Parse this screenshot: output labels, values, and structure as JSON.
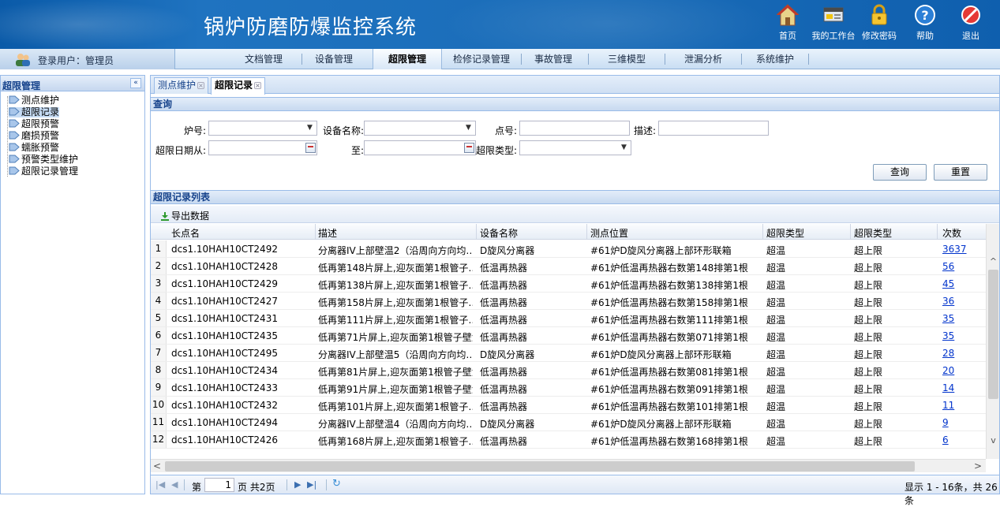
{
  "header": {
    "title": "锅炉防磨防爆监控系统",
    "tools": [
      {
        "icon": "home-icon",
        "label": "首页"
      },
      {
        "icon": "workbench-icon",
        "label": "我的工作台"
      },
      {
        "icon": "lock-icon",
        "label": "修改密码"
      },
      {
        "icon": "help-icon",
        "label": "帮助"
      },
      {
        "icon": "exit-icon",
        "label": "退出"
      }
    ]
  },
  "user": {
    "label": "登录用户：管理员"
  },
  "nav": {
    "items": [
      "文档管理",
      "设备管理",
      "超限管理",
      "检修记录管理",
      "事故管理",
      "三维模型",
      "泄漏分析",
      "系统维护"
    ],
    "active": "超限管理"
  },
  "sidebar": {
    "title": "超限管理",
    "collapse": "«",
    "items": [
      "测点维护",
      "超限记录",
      "超限预警",
      "磨损预警",
      "蠕胀预警",
      "预警类型维护",
      "超限记录管理"
    ],
    "selected": "超限记录"
  },
  "tabs": [
    {
      "label": "测点维护",
      "active": false
    },
    {
      "label": "超限记录",
      "active": true
    }
  ],
  "query": {
    "title": "查询",
    "labels": {
      "furnace": "炉号:",
      "device": "设备名称:",
      "point": "点号:",
      "desc": "描述:",
      "date_from": "超限日期从:",
      "date_to": "至:",
      "type": "超限类型:"
    },
    "values": {
      "furnace": "",
      "device": "",
      "point": "",
      "desc": "",
      "date_from": "",
      "date_to": "",
      "type": ""
    },
    "buttons": {
      "search": "查询",
      "reset": "重置"
    }
  },
  "list": {
    "title": "超限记录列表",
    "export_label": "导出数据",
    "columns": [
      "长点名",
      "描述",
      "设备名称",
      "测点位置",
      "超限类型",
      "超限类型",
      "次数"
    ],
    "rows": [
      {
        "n": "1",
        "c": [
          "dcs1.10HAH10CT2492",
          "分离器IV上部壁温2（沿周向方向均…",
          "D旋风分离器",
          "#61炉D旋风分离器上部环形联箱",
          "超温",
          "超上限",
          "3637"
        ]
      },
      {
        "n": "2",
        "c": [
          "dcs1.10HAH10CT2428",
          "低再第148片屏上,迎灰面第1根管子…",
          "低温再热器",
          "#61炉低温再热器右数第148排第1根",
          "超温",
          "超上限",
          "56"
        ]
      },
      {
        "n": "3",
        "c": [
          "dcs1.10HAH10CT2429",
          "低再第138片屏上,迎灰面第1根管子…",
          "低温再热器",
          "#61炉低温再热器右数第138排第1根",
          "超温",
          "超上限",
          "45"
        ]
      },
      {
        "n": "4",
        "c": [
          "dcs1.10HAH10CT2427",
          "低再第158片屏上,迎灰面第1根管子…",
          "低温再热器",
          "#61炉低温再热器右数第158排第1根",
          "超温",
          "超上限",
          "36"
        ]
      },
      {
        "n": "5",
        "c": [
          "dcs1.10HAH10CT2431",
          "低再第111片屏上,迎灰面第1根管子…",
          "低温再热器",
          "#61炉低温再热器右数第111排第1根",
          "超温",
          "超上限",
          "35"
        ]
      },
      {
        "n": "6",
        "c": [
          "dcs1.10HAH10CT2435",
          "低再第71片屏上,迎灰面第1根管子壁温",
          "低温再热器",
          "#61炉低温再热器右数第071排第1根",
          "超温",
          "超上限",
          "35"
        ]
      },
      {
        "n": "7",
        "c": [
          "dcs1.10HAH10CT2495",
          "分离器IV上部壁温5（沿周向方向均…",
          "D旋风分离器",
          "#61炉D旋风分离器上部环形联箱",
          "超温",
          "超上限",
          "28"
        ]
      },
      {
        "n": "8",
        "c": [
          "dcs1.10HAH10CT2434",
          "低再第81片屏上,迎灰面第1根管子壁温",
          "低温再热器",
          "#61炉低温再热器右数第081排第1根",
          "超温",
          "超上限",
          "20"
        ]
      },
      {
        "n": "9",
        "c": [
          "dcs1.10HAH10CT2433",
          "低再第91片屏上,迎灰面第1根管子壁温",
          "低温再热器",
          "#61炉低温再热器右数第091排第1根",
          "超温",
          "超上限",
          "14"
        ]
      },
      {
        "n": "10",
        "c": [
          "dcs1.10HAH10CT2432",
          "低再第101片屏上,迎灰面第1根管子…",
          "低温再热器",
          "#61炉低温再热器右数第101排第1根",
          "超温",
          "超上限",
          "11"
        ]
      },
      {
        "n": "11",
        "c": [
          "dcs1.10HAH10CT2494",
          "分离器IV上部壁温4（沿周向方向均…",
          "D旋风分离器",
          "#61炉D旋风分离器上部环形联箱",
          "超温",
          "超上限",
          "9"
        ]
      },
      {
        "n": "12",
        "c": [
          "dcs1.10HAH10CT2426",
          "低再第168片屏上,迎灰面第1根管子…",
          "低温再热器",
          "#61炉低温再热器右数第168排第1根",
          "超温",
          "超上限",
          "6"
        ]
      }
    ]
  },
  "pager": {
    "page_prefix": "第",
    "page_value": "1",
    "page_suffix": "页 共2页",
    "summary": "显示 1 - 16条，共 26条"
  },
  "colors": {
    "header_blue": "#1a6cb8",
    "panel_border": "#99bbe8",
    "title_blue": "#15428b",
    "link": "#0033cc"
  }
}
